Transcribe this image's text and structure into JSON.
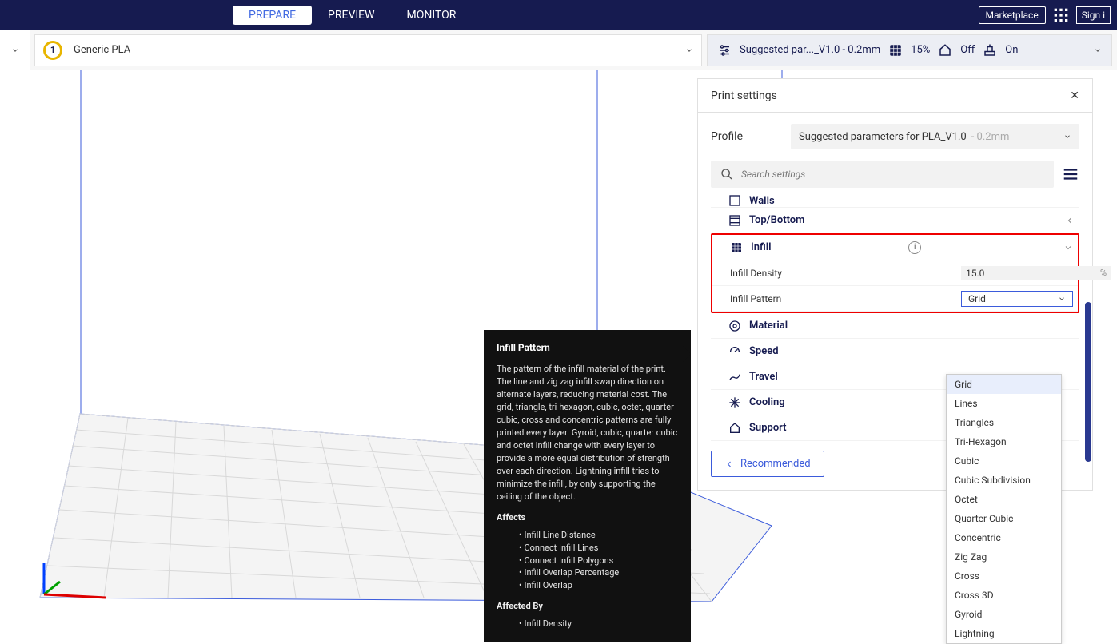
{
  "topbar": {
    "tabs": [
      "PREPARE",
      "PREVIEW",
      "MONITOR"
    ],
    "marketplace": "Marketplace",
    "signin": "Sign i"
  },
  "material": {
    "badge": "1",
    "name": "Generic PLA"
  },
  "settings_bar": {
    "profile": "Suggested par..._V1.0 - 0.2mm",
    "infill": "15%",
    "support": "Off",
    "adhesion": "On"
  },
  "panel": {
    "title": "Print settings",
    "profile_label": "Profile",
    "profile_value": "Suggested parameters for PLA_V1.0",
    "profile_dim": "- 0.2mm",
    "search_placeholder": "Search settings",
    "categories": {
      "walls": "Walls",
      "topbottom": "Top/Bottom",
      "infill": "Infill",
      "material": "Material",
      "speed": "Speed",
      "travel": "Travel",
      "cooling": "Cooling",
      "support": "Support"
    },
    "infill_density": {
      "label": "Infill Density",
      "value": "15.0",
      "unit": "%"
    },
    "infill_pattern": {
      "label": "Infill Pattern",
      "value": "Grid"
    },
    "recommended": "Recommended"
  },
  "tooltip": {
    "title": "Infill Pattern",
    "body": "The pattern of the infill material of the print. The line and zig zag infill swap direction on alternate layers, reducing material cost. The grid, triangle, tri-hexagon, cubic, octet, quarter cubic, cross and concentric patterns are fully printed every layer. Gyroid, cubic, quarter cubic and octet infill change with every layer to provide a more equal distribution of strength over each direction. Lightning infill tries to minimize the infill, by only supporting the ceiling of the object.",
    "affects_label": "Affects",
    "affects": [
      "Infill Line Distance",
      "Connect Infill Lines",
      "Connect Infill Polygons",
      "Infill Overlap Percentage",
      "Infill Overlap"
    ],
    "affected_by_label": "Affected By",
    "affected_by": [
      "Infill Density"
    ]
  },
  "dropdown": {
    "options": [
      "Grid",
      "Lines",
      "Triangles",
      "Tri-Hexagon",
      "Cubic",
      "Cubic Subdivision",
      "Octet",
      "Quarter Cubic",
      "Concentric",
      "Zig Zag",
      "Cross",
      "Cross 3D",
      "Gyroid",
      "Lightning"
    ]
  }
}
